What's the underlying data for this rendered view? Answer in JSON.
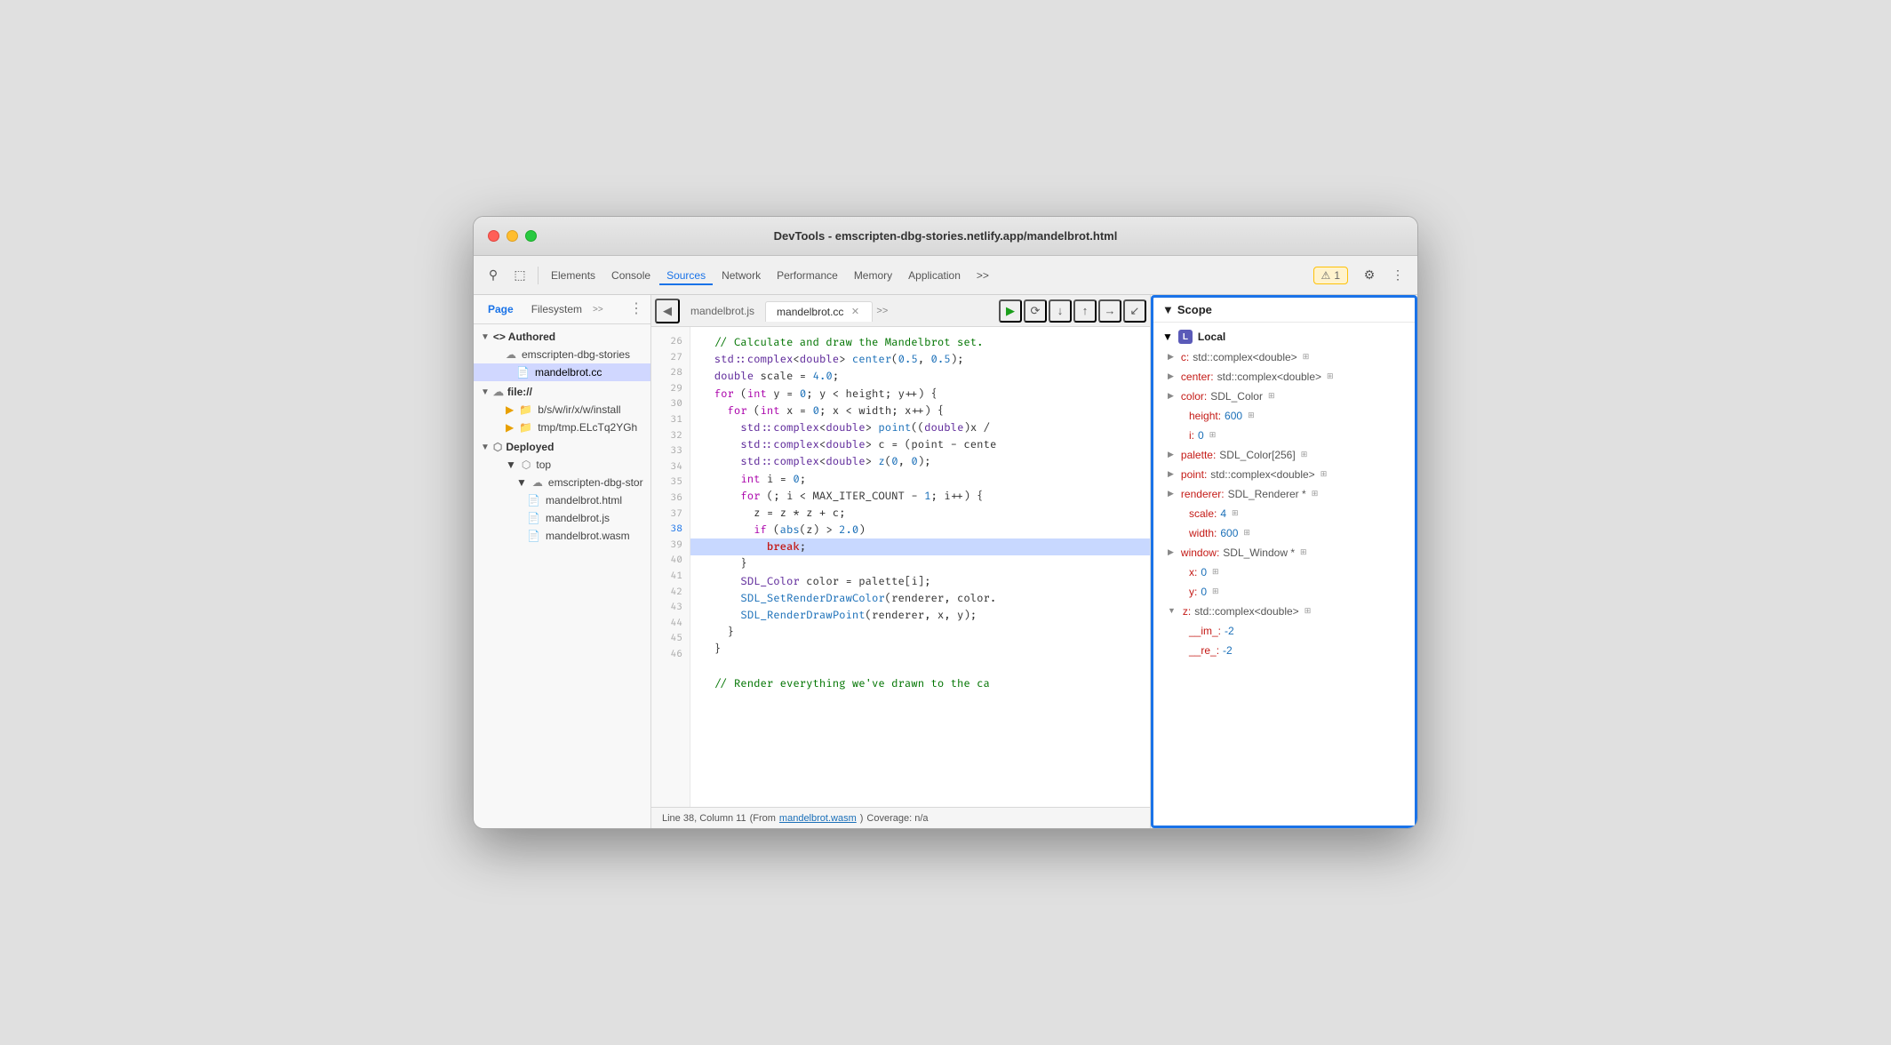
{
  "window": {
    "title": "DevTools - emscripten-dbg-stories.netlify.app/mandelbrot.html"
  },
  "toolbar": {
    "cursor_icon": "⚲",
    "device_icon": "⬚",
    "elements_label": "Elements",
    "console_label": "Console",
    "sources_label": "Sources",
    "network_label": "Network",
    "performance_label": "Performance",
    "memory_label": "Memory",
    "application_label": "Application",
    "more_label": ">>",
    "warning_count": "1",
    "settings_icon": "⚙",
    "more_icon": "⋮"
  },
  "sidebar": {
    "tabs": {
      "page": "Page",
      "filesystem": "Filesystem",
      "more": ">>"
    },
    "sections": {
      "authored": {
        "label": "Authored",
        "children": [
          {
            "type": "cloud",
            "label": "emscripten-dbg-stories",
            "indent": 1
          },
          {
            "type": "file-cc",
            "label": "mandelbrot.cc",
            "indent": 2,
            "selected": true
          }
        ]
      },
      "file": {
        "label": "file://",
        "children": [
          {
            "type": "folder",
            "label": "b/s/w/ir/x/w/install",
            "indent": 1
          },
          {
            "type": "folder",
            "label": "tmp/tmp.ELcTq2YGh",
            "indent": 1
          }
        ]
      },
      "deployed": {
        "label": "Deployed",
        "children": [
          {
            "type": "box",
            "label": "top",
            "indent": 1
          },
          {
            "type": "cloud",
            "label": "emscripten-dbg-stor",
            "indent": 2
          },
          {
            "type": "file-html",
            "label": "mandelbrot.html",
            "indent": 3
          },
          {
            "type": "file-js",
            "label": "mandelbrot.js",
            "indent": 3
          },
          {
            "type": "file-wasm",
            "label": "mandelbrot.wasm",
            "indent": 3
          }
        ]
      }
    }
  },
  "code": {
    "tabs": [
      {
        "label": "mandelbrot.js",
        "active": false,
        "closeable": false
      },
      {
        "label": "mandelbrot.cc",
        "active": true,
        "closeable": true
      }
    ],
    "lines": [
      {
        "num": 26,
        "content": "  // Calculate and draw the Mandelbrot set.",
        "type": "comment"
      },
      {
        "num": 27,
        "content": "  std::complex<double> center(0.5, 0.5);",
        "type": "code"
      },
      {
        "num": 28,
        "content": "  double scale = 4.0;",
        "type": "code"
      },
      {
        "num": 29,
        "content": "  for (int y = 0; y < height; y++) {",
        "type": "code"
      },
      {
        "num": 30,
        "content": "    for (int x = 0; x < width; x++) {",
        "type": "code"
      },
      {
        "num": 31,
        "content": "      std::complex<double> point((double)x /",
        "type": "code"
      },
      {
        "num": 32,
        "content": "      std::complex<double> c = (point - cente",
        "type": "code"
      },
      {
        "num": 33,
        "content": "      std::complex<double> z(0, 0);",
        "type": "code"
      },
      {
        "num": 34,
        "content": "      int i = 0;",
        "type": "code"
      },
      {
        "num": 35,
        "content": "      for (; i < MAX_ITER_COUNT - 1; i++) {",
        "type": "code"
      },
      {
        "num": 36,
        "content": "        z = z * z + c;",
        "type": "code"
      },
      {
        "num": 37,
        "content": "        if (abs(z) > 2.0)",
        "type": "code"
      },
      {
        "num": 38,
        "content": "          break;",
        "type": "code",
        "highlighted": true
      },
      {
        "num": 39,
        "content": "      }",
        "type": "code"
      },
      {
        "num": 40,
        "content": "      SDL_Color color = palette[i];",
        "type": "code"
      },
      {
        "num": 41,
        "content": "      SDL_SetRenderDrawColor(renderer, color.",
        "type": "code"
      },
      {
        "num": 42,
        "content": "      SDL_RenderDrawPoint(renderer, x, y);",
        "type": "code"
      },
      {
        "num": 43,
        "content": "    }",
        "type": "code"
      },
      {
        "num": 44,
        "content": "  }",
        "type": "code"
      },
      {
        "num": 45,
        "content": "",
        "type": "code"
      },
      {
        "num": 46,
        "content": "  // Render everything we've drawn to the ca",
        "type": "comment"
      }
    ],
    "status_line": "Line 38, Column 11",
    "status_from": "From",
    "status_file": "mandelbrot.wasm",
    "status_coverage": "Coverage: n/a"
  },
  "scope": {
    "header": "Scope",
    "section_label": "Local",
    "section_badge": "L",
    "items": [
      {
        "key": "c",
        "value": "std::complex<double>",
        "expandable": true,
        "has_icon": true
      },
      {
        "key": "center",
        "value": "std::complex<double>",
        "expandable": true,
        "has_icon": true
      },
      {
        "key": "color",
        "value": "SDL_Color",
        "expandable": true,
        "has_icon": true
      },
      {
        "key": "height",
        "value": "600",
        "expandable": false,
        "has_icon": true
      },
      {
        "key": "i",
        "value": "0",
        "expandable": false,
        "has_icon": true
      },
      {
        "key": "palette",
        "value": "SDL_Color[256]",
        "expandable": true,
        "has_icon": true
      },
      {
        "key": "point",
        "value": "std::complex<double>",
        "expandable": true,
        "has_icon": true
      },
      {
        "key": "renderer",
        "value": "SDL_Renderer *",
        "expandable": true,
        "has_icon": true
      },
      {
        "key": "scale",
        "value": "4",
        "expandable": false,
        "has_icon": true
      },
      {
        "key": "width",
        "value": "600",
        "expandable": false,
        "has_icon": true
      },
      {
        "key": "window",
        "value": "SDL_Window *",
        "expandable": true,
        "has_icon": true
      },
      {
        "key": "x",
        "value": "0",
        "expandable": false,
        "has_icon": true
      },
      {
        "key": "y",
        "value": "0",
        "expandable": false,
        "has_icon": true
      },
      {
        "key": "z",
        "value": "std::complex<double>",
        "expandable": true,
        "has_icon": true,
        "expanded": true
      },
      {
        "key": "__im_",
        "value": "-2",
        "expandable": false,
        "has_icon": false,
        "sub": true
      },
      {
        "key": "__re_",
        "value": "-2",
        "expandable": false,
        "has_icon": false,
        "sub": true
      }
    ]
  },
  "debug_controls": {
    "play": "▶",
    "step_over": "↺",
    "step_into": "↓",
    "step_out": "↑",
    "step_next": "→•",
    "deactivate": "↙"
  }
}
